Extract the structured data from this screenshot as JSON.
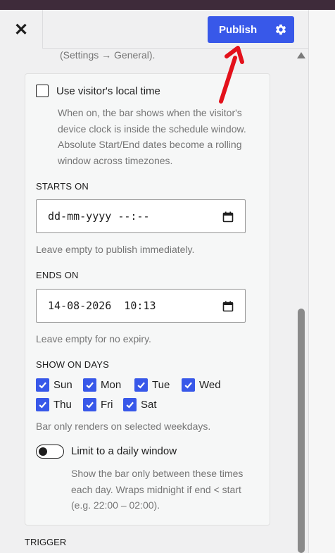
{
  "header": {
    "close_glyph": "✕",
    "publish_label": "Publish"
  },
  "settings_note": "(Settings → General).",
  "local_time": {
    "label": "Use visitor's local time",
    "help": "When on, the bar shows when the visitor's device clock is inside the schedule window. Absolute Start/End dates become a rolling window across timezones.",
    "checked": false
  },
  "starts_on": {
    "title": "STARTS ON",
    "value": "dd-mm-yyyy --:--",
    "help": "Leave empty to publish immediately."
  },
  "ends_on": {
    "title": "ENDS ON",
    "value": "14-08-2026  10:13",
    "help": "Leave empty for no expiry."
  },
  "show_on_days": {
    "title": "SHOW ON DAYS",
    "days": [
      {
        "label": "Sun",
        "checked": true
      },
      {
        "label": "Mon",
        "checked": true
      },
      {
        "label": "Tue",
        "checked": true
      },
      {
        "label": "Wed",
        "checked": true
      },
      {
        "label": "Thu",
        "checked": true
      },
      {
        "label": "Fri",
        "checked": true
      },
      {
        "label": "Sat",
        "checked": true
      }
    ],
    "help": "Bar only renders on selected weekdays."
  },
  "daily_window": {
    "label": "Limit to a daily window",
    "enabled": false,
    "help_lines": [
      "Show the bar only between these times",
      "each day. Wraps midnight if end < start",
      "(e.g. 22:00 – 02:00)."
    ]
  },
  "next_section": "TRIGGER",
  "colors": {
    "accent": "#3858e9",
    "annotation_arrow": "#e3111b"
  },
  "icons": {
    "close": "close-icon",
    "settings": "gear-icon",
    "calendar": "calendar-icon",
    "check": "checkmark-icon"
  }
}
